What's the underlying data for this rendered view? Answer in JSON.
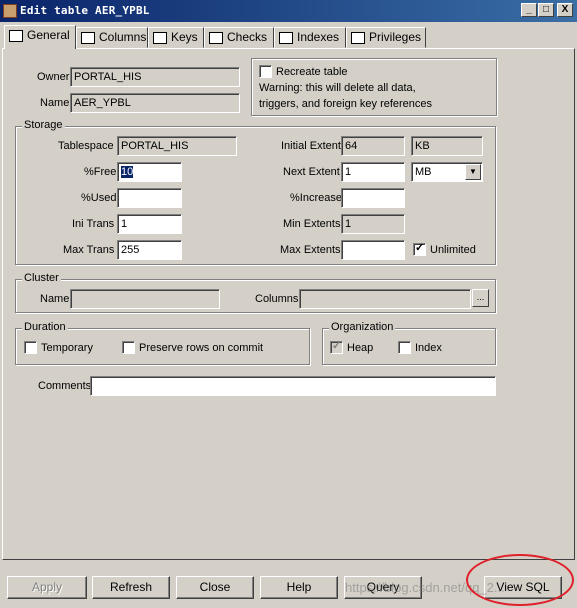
{
  "window": {
    "title": "Edit table AER_YPBL",
    "min_btn": "_",
    "max_btn": "□",
    "close_btn": "X"
  },
  "tabs": [
    {
      "label": "General",
      "icon": "general-tab-icon"
    },
    {
      "label": "Columns",
      "icon": "columns-tab-icon"
    },
    {
      "label": "Keys",
      "icon": "keys-tab-icon"
    },
    {
      "label": "Checks",
      "icon": "checks-tab-icon"
    },
    {
      "label": "Indexes",
      "icon": "indexes-tab-icon"
    },
    {
      "label": "Privileges",
      "icon": "privileges-tab-icon"
    }
  ],
  "general": {
    "owner_label": "Owner",
    "owner_value": "PORTAL_HIS",
    "name_label": "Name",
    "name_value": "AER_YPBL",
    "recreate_label": "Recreate table",
    "recreate_warning_1": "Warning: this will delete all data,",
    "recreate_warning_2": "triggers, and foreign key references"
  },
  "storage": {
    "group_label": "Storage",
    "tablespace_label": "Tablespace",
    "tablespace_value": "PORTAL_HIS",
    "pctfree_label": "%Free",
    "pctfree_value": "10",
    "pctused_label": "%Used",
    "pctused_value": "",
    "initrans_label": "Ini Trans",
    "initrans_value": "1",
    "maxtrans_label": "Max Trans",
    "maxtrans_value": "255",
    "initial_extent_label": "Initial Extent",
    "initial_extent_value": "64",
    "initial_extent_unit": "KB",
    "next_extent_label": "Next Extent",
    "next_extent_value": "1",
    "next_extent_unit": "MB",
    "pctincrease_label": "%Increase",
    "pctincrease_value": "",
    "min_extents_label": "Min Extents",
    "min_extents_value": "1",
    "max_extents_label": "Max Extents",
    "max_extents_value": "",
    "unlimited_label": "Unlimited",
    "unlimited_checked": true
  },
  "cluster": {
    "group_label": "Cluster",
    "name_label": "Name",
    "name_value": "",
    "columns_label": "Columns",
    "columns_value": "",
    "browse_label": "..."
  },
  "duration": {
    "group_label": "Duration",
    "temporary_label": "Temporary",
    "preserve_label": "Preserve rows on commit"
  },
  "organization": {
    "group_label": "Organization",
    "heap_label": "Heap",
    "heap_checked": true,
    "index_label": "Index"
  },
  "comments": {
    "label": "Comments",
    "value": ""
  },
  "buttons": {
    "apply": "Apply",
    "refresh": "Refresh",
    "close": "Close",
    "help": "Help",
    "query": "Query",
    "view_sql": "View SQL"
  },
  "watermark": "https://blog.csdn.net/qq_2...",
  "colors": {
    "titlebar": "#0a246a",
    "face": "#d4d0c8",
    "annotation": "#e0202a"
  }
}
